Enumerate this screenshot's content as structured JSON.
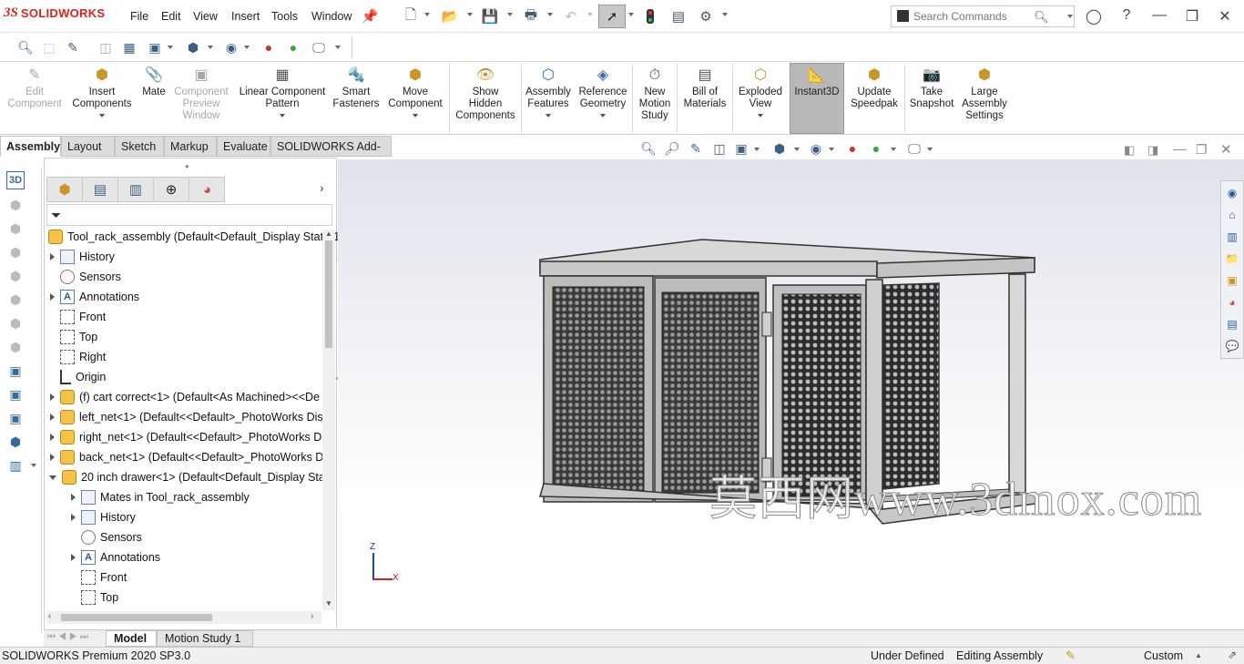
{
  "app": {
    "brand": "SOLIDWORKS",
    "brand_color": "#d9261c"
  },
  "menu": [
    "File",
    "Edit",
    "View",
    "Insert",
    "Tools",
    "Window"
  ],
  "search": {
    "placeholder": "Search Commands"
  },
  "commands": [
    {
      "label": "Edit\nComponent",
      "icon": "edit-component-icon",
      "disabled": true
    },
    {
      "label": "Insert\nComponents",
      "icon": "insert-components-icon",
      "disabled": false
    },
    {
      "label": "Mate",
      "icon": "mate-icon",
      "disabled": false
    },
    {
      "label": "Component\nPreview\nWindow",
      "icon": "component-preview-icon",
      "disabled": true
    },
    {
      "label": "Linear Component\nPattern",
      "icon": "linear-pattern-icon",
      "disabled": false
    },
    {
      "label": "Smart\nFasteners",
      "icon": "smart-fasteners-icon",
      "disabled": false
    },
    {
      "label": "Move\nComponent",
      "icon": "move-component-icon",
      "disabled": false
    },
    {
      "label": "Show\nHidden\nComponents",
      "icon": "show-hidden-icon",
      "disabled": false
    },
    {
      "label": "Assembly\nFeatures",
      "icon": "assembly-features-icon",
      "disabled": false
    },
    {
      "label": "Reference\nGeometry",
      "icon": "reference-geometry-icon",
      "disabled": false
    },
    {
      "label": "New\nMotion\nStudy",
      "icon": "motion-study-icon",
      "disabled": false
    },
    {
      "label": "Bill of\nMaterials",
      "icon": "bom-icon",
      "disabled": false
    },
    {
      "label": "Exploded\nView",
      "icon": "exploded-view-icon",
      "disabled": false
    },
    {
      "label": "Instant3D",
      "icon": "instant3d-icon",
      "disabled": false,
      "active": true
    },
    {
      "label": "Update\nSpeedpak",
      "icon": "speedpak-icon",
      "disabled": false
    },
    {
      "label": "Take\nSnapshot",
      "icon": "snapshot-icon",
      "disabled": false
    },
    {
      "label": "Large\nAssembly\nSettings",
      "icon": "large-assembly-icon",
      "disabled": false
    }
  ],
  "tabs": [
    "Assembly",
    "Layout",
    "Sketch",
    "Markup",
    "Evaluate",
    "SOLIDWORKS Add-Ins"
  ],
  "tree": [
    {
      "label": "Tool_rack_assembly  (Default<Default_Display State-1",
      "icon": "asm"
    },
    {
      "label": "History",
      "icon": "fold"
    },
    {
      "label": "Sensors",
      "icon": "sens"
    },
    {
      "label": "Annotations",
      "icon": "ann"
    },
    {
      "label": "Front",
      "icon": "plane"
    },
    {
      "label": "Top",
      "icon": "plane"
    },
    {
      "label": "Right",
      "icon": "plane"
    },
    {
      "label": "Origin",
      "icon": "orig"
    },
    {
      "label": "(f) cart correct<1> (Default<As Machined><<De",
      "icon": "asm"
    },
    {
      "label": "left_net<1> (Default<<Default>_PhotoWorks Dis",
      "icon": "asm"
    },
    {
      "label": "right_net<1> (Default<<Default>_PhotoWorks D",
      "icon": "asm"
    },
    {
      "label": "back_net<1> (Default<<Default>_PhotoWorks D",
      "icon": "asm"
    },
    {
      "label": "20 inch drawer<1> (Default<Default_Display Stat",
      "icon": "asm"
    },
    {
      "label": "Mates in Tool_rack_assembly",
      "icon": "fold"
    },
    {
      "label": "History",
      "icon": "fold"
    },
    {
      "label": "Sensors",
      "icon": "sens"
    },
    {
      "label": "Annotations",
      "icon": "ann"
    },
    {
      "label": "Front",
      "icon": "plane"
    },
    {
      "label": "Top",
      "icon": "plane"
    }
  ],
  "watermark": "莫西网www.3dmox.com",
  "triad": {
    "z": "Z",
    "x": "X"
  },
  "bottom_tabs": [
    "Model",
    "Motion Study 1"
  ],
  "status": {
    "product": "SOLIDWORKS Premium 2020 SP3.0",
    "definition": "Under Defined",
    "mode": "Editing Assembly",
    "units": "Custom"
  }
}
